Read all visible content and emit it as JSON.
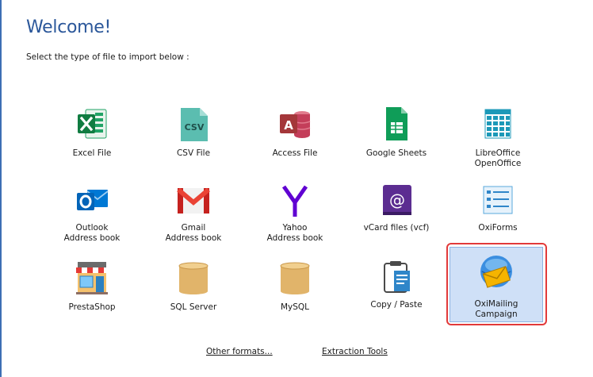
{
  "title": "Welcome!",
  "subtitle": "Select the type of file to import below :",
  "tiles": [
    {
      "label": "Excel File",
      "icon": "excel-icon"
    },
    {
      "label": "CSV File",
      "icon": "csv-icon",
      "badge": "CSV"
    },
    {
      "label": "Access File",
      "icon": "access-icon"
    },
    {
      "label": "Google Sheets",
      "icon": "google-sheets-icon"
    },
    {
      "label": "LibreOffice\nOpenOffice",
      "icon": "libreoffice-icon"
    },
    {
      "label": "Outlook\nAddress book",
      "icon": "outlook-icon"
    },
    {
      "label": "Gmail\nAddress book",
      "icon": "gmail-icon"
    },
    {
      "label": "Yahoo\nAddress book",
      "icon": "yahoo-icon"
    },
    {
      "label": "vCard files (vcf)",
      "icon": "vcard-icon"
    },
    {
      "label": "OxiForms",
      "icon": "oxiforms-icon"
    },
    {
      "label": "PrestaShop",
      "icon": "prestashop-icon"
    },
    {
      "label": "SQL Server",
      "icon": "database-icon"
    },
    {
      "label": "MySQL",
      "icon": "database-icon"
    },
    {
      "label": "Copy / Paste",
      "icon": "clipboard-icon"
    },
    {
      "label": "OxiMailing\nCampaign",
      "icon": "oximailing-icon",
      "selected": true
    }
  ],
  "links": {
    "other_formats": "Other formats...",
    "extraction_tools": "Extraction Tools"
  },
  "colors": {
    "title": "#2b579a",
    "selection_bg": "#cfe0f7",
    "selection_outline": "#e23a3a"
  }
}
